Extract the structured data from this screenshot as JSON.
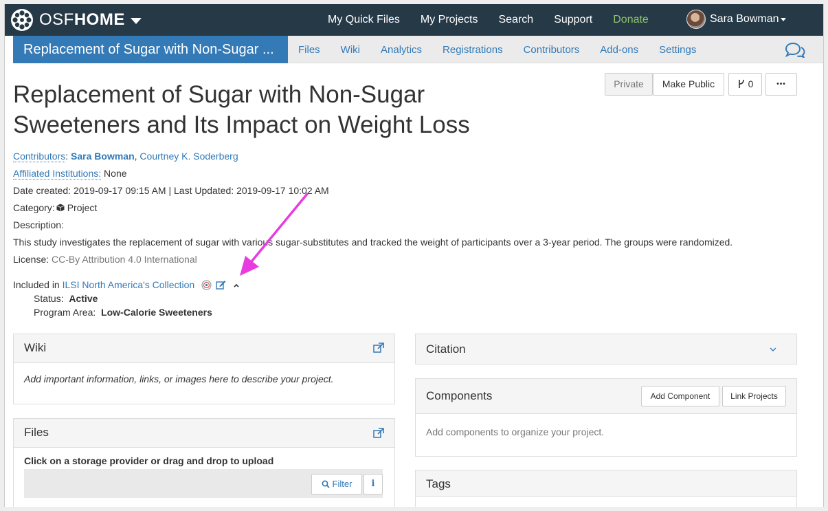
{
  "topnav": {
    "brand_light": "OSF",
    "brand_bold": "HOME",
    "links": [
      "My Quick Files",
      "My Projects",
      "Search",
      "Support",
      "Donate"
    ],
    "user_name": "Sara Bowman"
  },
  "projnav": {
    "title": "Replacement of Sugar with Non-Sugar ...",
    "links": [
      "Files",
      "Wiki",
      "Analytics",
      "Registrations",
      "Contributors",
      "Add-ons",
      "Settings"
    ]
  },
  "header_buttons": {
    "private": "Private",
    "make_public": "Make Public",
    "fork_count": "0",
    "more": "•••"
  },
  "project": {
    "title": "Replacement of Sugar with Non-Sugar Sweeteners and Its Impact on Weight Loss",
    "contributors_label": "Contributors",
    "contributor_1": "Sara Bowman",
    "contributor_2": "Courtney K. Soderberg",
    "affiliated_label": "Affiliated Institutions:",
    "affiliated_value": " None",
    "dates": "Date created: 2019-09-17 09:15 AM | Last Updated: 2019-09-17 10:02 AM",
    "category_label": "Category:",
    "category_value": "Project",
    "description_label": "Description:",
    "description": "This study investigates the replacement of sugar with various sugar-substitutes and tracked the weight of participants over a 3-year period. The groups were randomized.",
    "license_label": "License:",
    "license_value": "CC-By Attribution 4.0 International",
    "included_label": "Included in",
    "collection_name": "ILSI North America's Collection",
    "status_label": "Status:",
    "status_value": "Active",
    "program_label": "Program Area:",
    "program_value": "Low-Calorie Sweeteners"
  },
  "wiki": {
    "title": "Wiki",
    "body": "Add important information, links, or images here to describe your project."
  },
  "files": {
    "title": "Files",
    "instructions": "Click on a storage provider or drag and drop to upload",
    "filter_label": "Filter",
    "info_label": "i"
  },
  "citation": {
    "title": "Citation"
  },
  "components": {
    "title": "Components",
    "add_label": "Add Component",
    "link_label": "Link Projects",
    "body": "Add components to organize your project."
  },
  "tags": {
    "title": "Tags"
  },
  "colors": {
    "nav_bg": "#263947",
    "accent": "#337ab7",
    "donate": "#8fc26e",
    "annotation": "#e83ce0"
  }
}
